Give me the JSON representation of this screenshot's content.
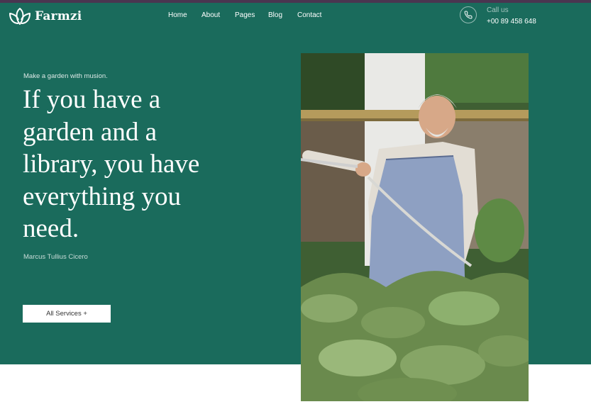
{
  "brand": {
    "name": "Farmzi",
    "logo_icon": "lotus-icon"
  },
  "nav": {
    "items": [
      {
        "label": "Home"
      },
      {
        "label": "About"
      },
      {
        "label": "Pages"
      },
      {
        "label": "Blog"
      },
      {
        "label": "Contact"
      }
    ]
  },
  "contact": {
    "label": "Call us",
    "phone": "+00 89 458 648",
    "icon": "phone-icon"
  },
  "hero": {
    "tagline": "Make a garden with musion.",
    "headline": "If you have a garden and a library, you have everything you need.",
    "author": "Marcus Tullius Cicero",
    "button_label": "All Services +"
  },
  "colors": {
    "hero_background": "#1a6b5c",
    "top_border": "#4a3550",
    "text": "#ffffff",
    "button_background": "#ffffff"
  }
}
